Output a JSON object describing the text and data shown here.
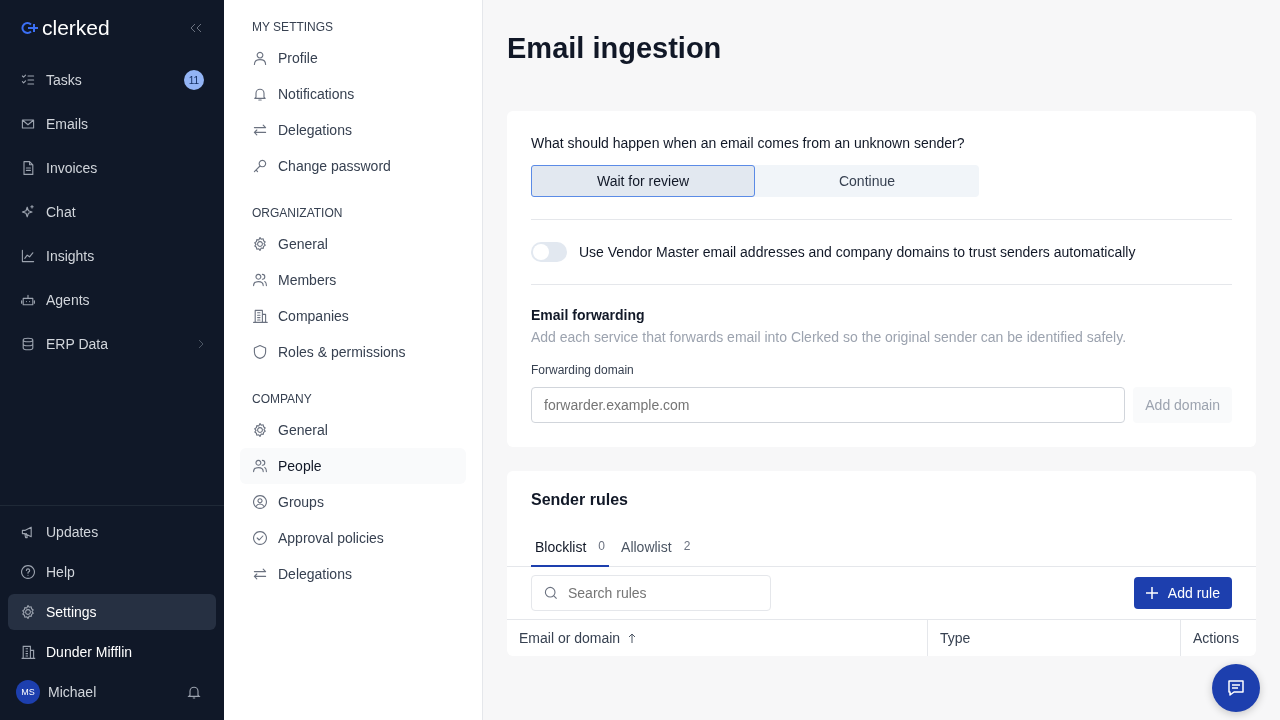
{
  "brand": {
    "name": "clerked"
  },
  "sidebar": {
    "items": [
      {
        "label": "Tasks",
        "badge": "11",
        "selected": false,
        "expandable": false
      },
      {
        "label": "Emails",
        "selected": false,
        "expandable": false
      },
      {
        "label": "Invoices",
        "selected": false,
        "expandable": false
      },
      {
        "label": "Chat",
        "selected": false,
        "expandable": false
      },
      {
        "label": "Insights",
        "selected": false,
        "expandable": false
      },
      {
        "label": "Agents",
        "selected": false,
        "expandable": false
      },
      {
        "label": "ERP Data",
        "selected": false,
        "expandable": true
      }
    ],
    "bottom_items": [
      {
        "label": "Updates",
        "selected": false
      },
      {
        "label": "Help",
        "selected": false
      },
      {
        "label": "Settings",
        "selected": true
      }
    ],
    "company": "Dunder Mifflin",
    "user": {
      "initials": "MS",
      "name": "Michael"
    }
  },
  "settings_nav": [
    {
      "heading": "MY SETTINGS",
      "items": [
        {
          "label": "Profile",
          "selected": false
        },
        {
          "label": "Notifications",
          "selected": false
        },
        {
          "label": "Delegations",
          "selected": false
        },
        {
          "label": "Change password",
          "selected": false
        }
      ]
    },
    {
      "heading": "ORGANIZATION",
      "items": [
        {
          "label": "General",
          "selected": false
        },
        {
          "label": "Members",
          "selected": false
        },
        {
          "label": "Companies",
          "selected": false
        },
        {
          "label": "Roles & permissions",
          "selected": false
        }
      ]
    },
    {
      "heading": "COMPANY",
      "items": [
        {
          "label": "General",
          "selected": false
        },
        {
          "label": "People",
          "selected": true
        },
        {
          "label": "Groups",
          "selected": false
        },
        {
          "label": "Approval policies",
          "selected": false
        },
        {
          "label": "Delegations",
          "selected": false
        }
      ]
    }
  ],
  "page": {
    "title": "Email ingestion"
  },
  "unknown_sender": {
    "question": "What should happen when an email comes from an unknown sender?",
    "options": [
      {
        "label": "Wait for review",
        "selected": true
      },
      {
        "label": "Continue",
        "selected": false
      }
    ]
  },
  "vendor_toggle": {
    "label": "Use Vendor Master email addresses and company domains to trust senders automatically",
    "on": false
  },
  "forwarding": {
    "title": "Email forwarding",
    "description": "Add each service that forwards email into Clerked so the original sender can be identified safely.",
    "field_label": "Forwarding domain",
    "placeholder": "forwarder.example.com",
    "button": "Add domain",
    "button_disabled": true
  },
  "sender_rules": {
    "title": "Sender rules",
    "tabs": [
      {
        "label": "Blocklist",
        "count": "0",
        "selected": true
      },
      {
        "label": "Allowlist",
        "count": "2",
        "selected": false
      }
    ],
    "search": {
      "placeholder": "Search rules"
    },
    "add_button": "Add rule",
    "columns": [
      {
        "label": "Email or domain",
        "sorted": true
      },
      {
        "label": "Type",
        "sorted": false
      },
      {
        "label": "Actions",
        "sorted": false
      }
    ]
  }
}
